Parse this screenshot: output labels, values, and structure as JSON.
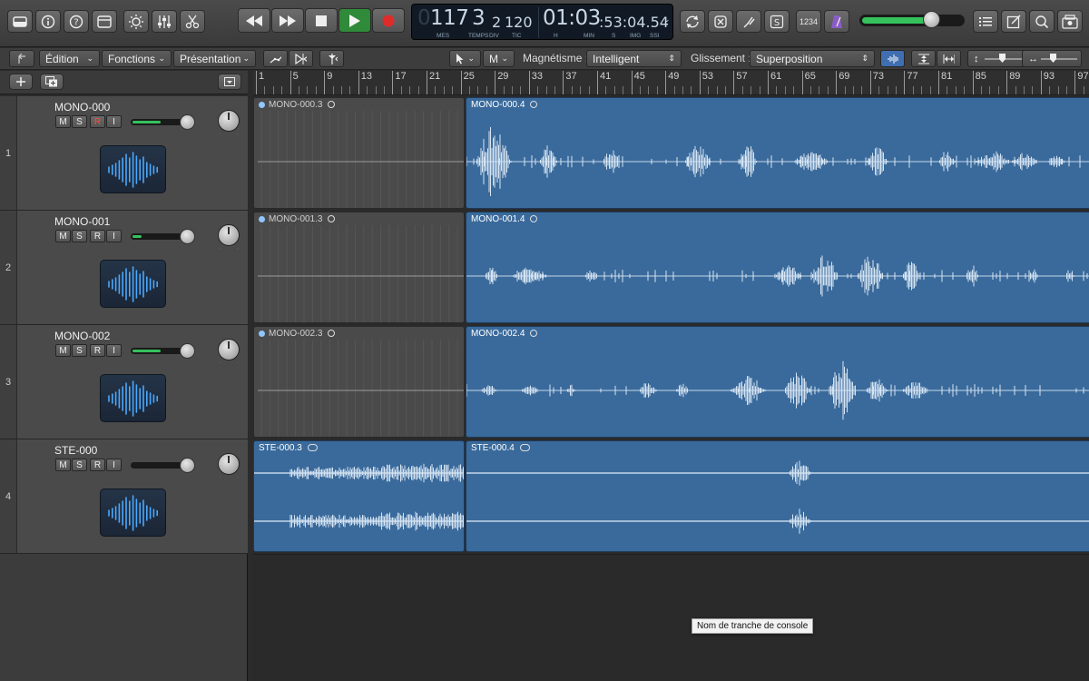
{
  "lcd": {
    "bar": "117",
    "beat": "3",
    "div": "2",
    "tick": "120",
    "time": "01:03",
    "frames": ":53:04.54",
    "labels": [
      "MES",
      "TEMPS",
      "DIV",
      "TIC",
      "H",
      "MIN",
      "S",
      "IMG",
      "SSI"
    ]
  },
  "toolbar": {
    "menu_edit": "Édition",
    "menu_functions": "Fonctions",
    "menu_view": "Présentation",
    "pointer_tool": "M",
    "snap_label": "Magnétisme :",
    "snap_value": "Intelligent",
    "drag_label": "Glissement :",
    "drag_value": "Superposition"
  },
  "counter_display": "1234",
  "ruler": [
    "1",
    "5",
    "9",
    "13",
    "17",
    "21",
    "25",
    "29",
    "33",
    "37",
    "41",
    "45",
    "49",
    "53",
    "57",
    "61",
    "65",
    "69",
    "73",
    "77",
    "81",
    "85",
    "89",
    "93",
    "97"
  ],
  "tracks": [
    {
      "index": "1",
      "name": "MONO-000",
      "rec": true,
      "level": 0.45
    },
    {
      "index": "2",
      "name": "MONO-001",
      "rec": false,
      "level": 0.15
    },
    {
      "index": "3",
      "name": "MONO-002",
      "rec": false,
      "level": 0.45
    },
    {
      "index": "4",
      "name": "STE-000",
      "rec": false,
      "level": 0
    }
  ],
  "regions": [
    {
      "track": 0,
      "name": "MONO-000.3",
      "kind": "grey"
    },
    {
      "track": 0,
      "name": "MONO-000.4",
      "kind": "blue"
    },
    {
      "track": 1,
      "name": "MONO-001.3",
      "kind": "grey"
    },
    {
      "track": 1,
      "name": "MONO-001.4",
      "kind": "blue"
    },
    {
      "track": 2,
      "name": "MONO-002.3",
      "kind": "grey"
    },
    {
      "track": 2,
      "name": "MONO-002.4",
      "kind": "blue"
    },
    {
      "track": 3,
      "name": "STE-000.3",
      "kind": "blue-stereo"
    },
    {
      "track": 3,
      "name": "STE-000.4",
      "kind": "blue-stereo"
    }
  ],
  "tooltip": "Nom de tranche de console",
  "colors": {
    "region_blue": "#3a6a9b",
    "play_green": "#2f8a3a",
    "record_red": "#e02b2b",
    "meter_green": "#35c25c"
  }
}
